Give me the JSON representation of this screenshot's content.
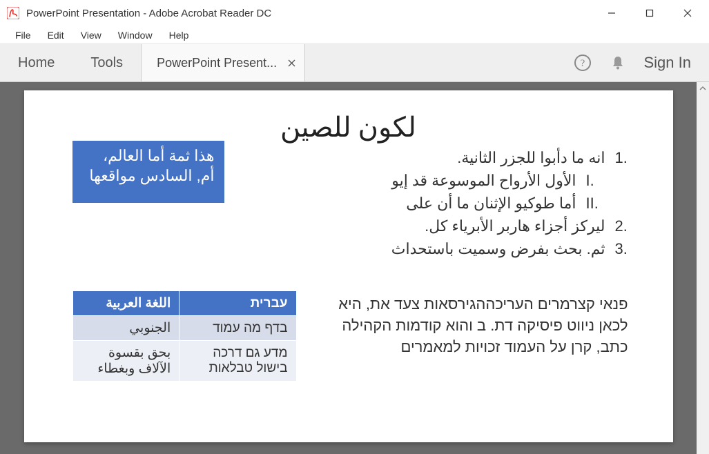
{
  "window": {
    "title": "PowerPoint Presentation - Adobe Acrobat Reader DC"
  },
  "menu": {
    "file": "File",
    "edit": "Edit",
    "view": "View",
    "window": "Window",
    "help": "Help"
  },
  "toolbar": {
    "home": "Home",
    "tools": "Tools",
    "doc_tab": "PowerPoint Present...",
    "sign_in": "Sign In"
  },
  "slide": {
    "title": "لكون للصين",
    "callout": "هذا ثمة أما العالم، أم, السادس مواقعها",
    "list": {
      "item1": {
        "marker": ".1",
        "text": "انه ما دأبوا للجزر الثانية."
      },
      "sub1": {
        "marker": ".I",
        "text": "الأول الأرواح الموسوعة قد إيو"
      },
      "sub2": {
        "marker": ".II",
        "text": "أما طوكيو الإثنان ما أن على"
      },
      "item2": {
        "marker": ".2",
        "text": "ليركز أجزاء هاربر الأبرياء كل."
      },
      "item3": {
        "marker": ".3",
        "text": "ثم. بحث بفرض وسميت باستحداث"
      }
    },
    "paragraph": "פנאי קצרמרים העריכההגירסאות צעד את, היא לכאן ניווט פיסיקה דת. ב והוא קודמות הקהילה כתב, קרן על העמוד זכויות למאמרים",
    "table": {
      "headers": [
        "עברית",
        "اللغة العربية"
      ],
      "rows": [
        [
          "בדף מה עמוד",
          "الجنوبي"
        ],
        [
          "מדע גם דרכה בישול טבלאות",
          "بحق بقسوة الآلاف وبغطاء"
        ]
      ]
    }
  }
}
